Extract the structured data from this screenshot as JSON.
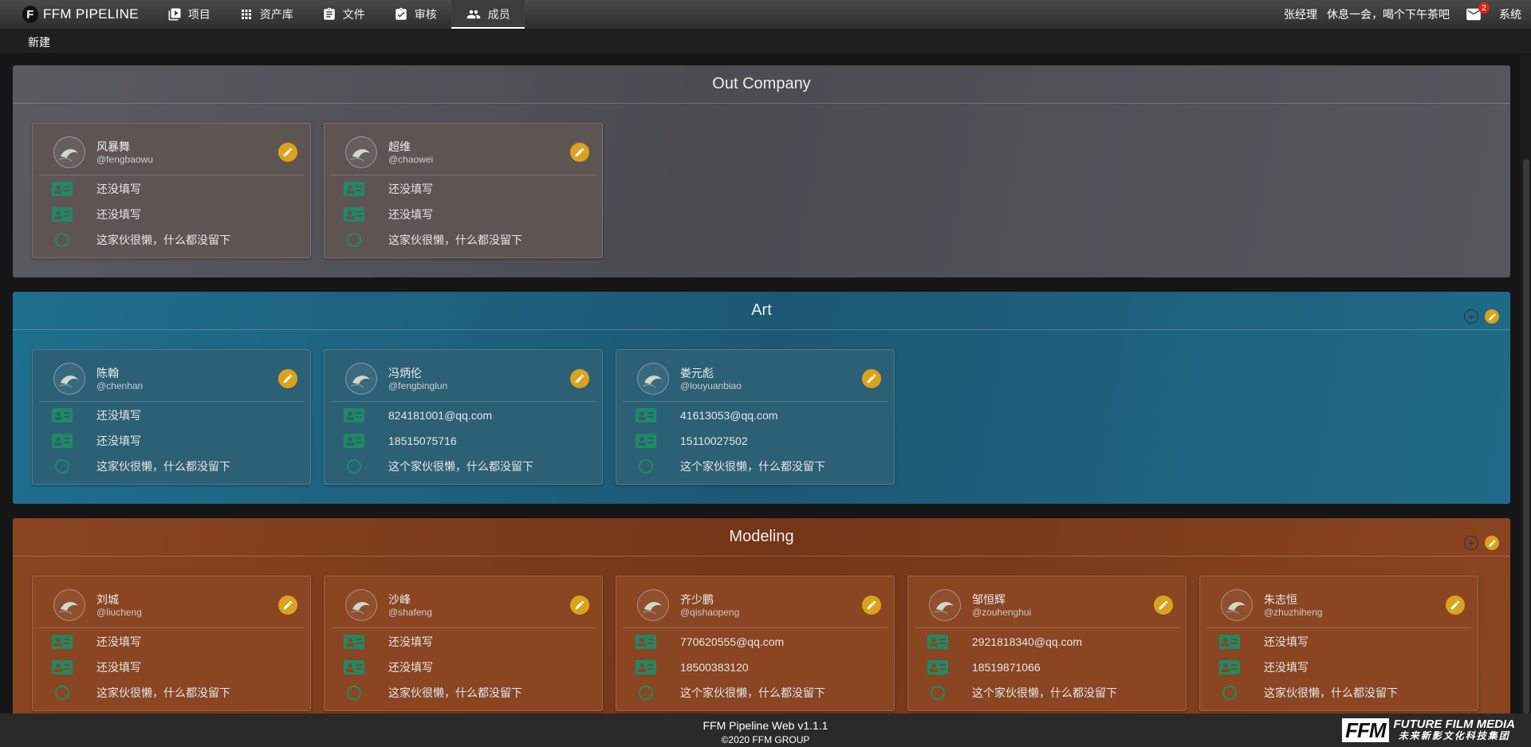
{
  "app": {
    "title": "FFM PIPELINE",
    "logo_letter": "F"
  },
  "nav": [
    {
      "label": "项目",
      "icon": "play-box-icon",
      "active": false
    },
    {
      "label": "资产库",
      "icon": "grid-icon",
      "active": false
    },
    {
      "label": "文件",
      "icon": "clipboard-icon",
      "active": false
    },
    {
      "label": "审核",
      "icon": "clipboard-check-icon",
      "active": false
    },
    {
      "label": "成员",
      "icon": "people-icon",
      "active": true
    }
  ],
  "user": {
    "name": "张经理",
    "message": "休息一会，喝个下午茶吧",
    "mail_count": "2",
    "system_label": "系统"
  },
  "toolbar": {
    "new_label": "新建"
  },
  "colors": {
    "accent": "#d9a31f",
    "row_icon": "#1f8a63",
    "out_company_bg": "#55555d",
    "art_bg": "#1f6482",
    "modeling_bg": "#7f3f1f"
  },
  "groups": [
    {
      "name": "Out Company",
      "actions": false,
      "members": [
        {
          "name": "风暴舞",
          "handle": "@fengbaowu",
          "email": "还没填写",
          "phone": "还没填写",
          "bio": "这家伙很懒，什么都没留下"
        },
        {
          "name": "超维",
          "handle": "@chaowei",
          "email": "还没填写",
          "phone": "还没填写",
          "bio": "这家伙很懒，什么都没留下"
        }
      ]
    },
    {
      "name": "Art",
      "actions": true,
      "members": [
        {
          "name": "陈翰",
          "handle": "@chenhan",
          "email": "还没填写",
          "phone": "还没填写",
          "bio": "这家伙很懒，什么都没留下"
        },
        {
          "name": "冯炳伦",
          "handle": "@fengbinglun",
          "email": "824181001@qq.com",
          "phone": "18515075716",
          "bio": "这个家伙很懒，什么都没留下"
        },
        {
          "name": "娄元彪",
          "handle": "@louyuanbiao",
          "email": "41613053@qq.com",
          "phone": "15110027502",
          "bio": "这个家伙很懒，什么都没留下"
        }
      ]
    },
    {
      "name": "Modeling",
      "actions": true,
      "members": [
        {
          "name": "刘城",
          "handle": "@liucheng",
          "email": "还没填写",
          "phone": "还没填写",
          "bio": "这家伙很懒，什么都没留下"
        },
        {
          "name": "沙峰",
          "handle": "@shafeng",
          "email": "还没填写",
          "phone": "还没填写",
          "bio": "这家伙很懒，什么都没留下"
        },
        {
          "name": "齐少鹏",
          "handle": "@qishaopeng",
          "email": "770620555@qq.com",
          "phone": "18500383120",
          "bio": "这个家伙很懒，什么都没留下"
        },
        {
          "name": "邹恒辉",
          "handle": "@zouhenghui",
          "email": "2921818340@qq.com",
          "phone": "18519871066",
          "bio": "这个家伙很懒，什么都没留下"
        },
        {
          "name": "朱志恒",
          "handle": "@zhuzhiheng",
          "email": "还没填写",
          "phone": "还没填写",
          "bio": "这家伙很懒，什么都没留下"
        }
      ]
    }
  ],
  "footer": {
    "version": "FFM Pipeline Web  v1.1.1",
    "copyright": "©2020 FFM GROUP",
    "logo_mark": "FFM",
    "logo_title": "FUTURE FILM MEDIA",
    "logo_subtitle": "未来新影文化科技集团"
  }
}
